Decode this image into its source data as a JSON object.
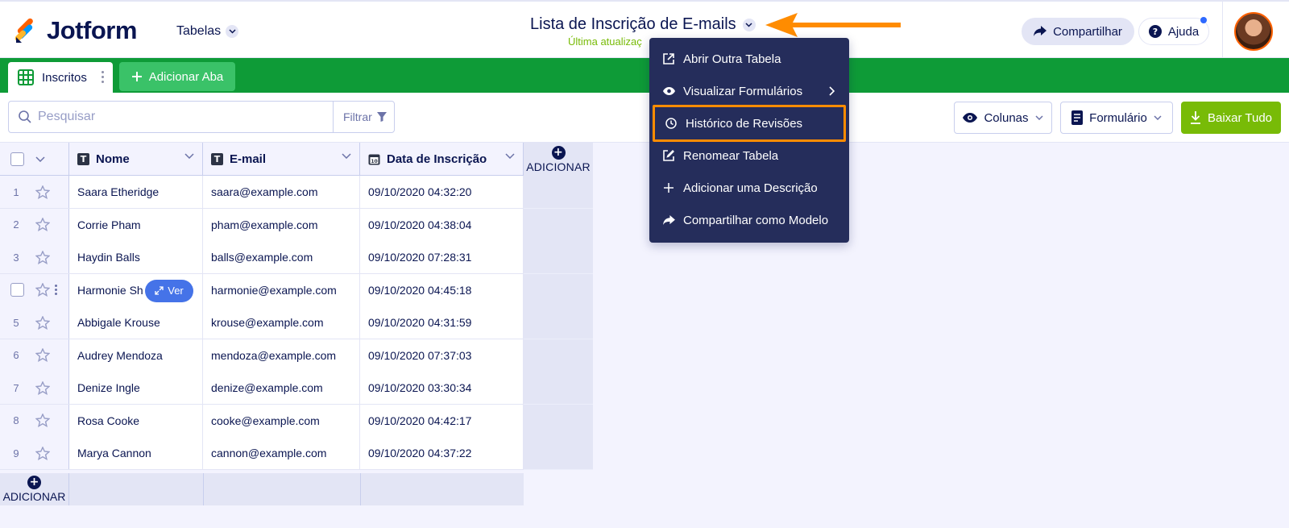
{
  "app": {
    "logo_text": "Jotform",
    "tables_label": "Tabelas",
    "table_title": "Lista de Inscrição de E-mails",
    "last_update": "Última atualizaç",
    "share_label": "Compartilhar",
    "help_label": "Ajuda"
  },
  "tabs": {
    "active_label": "Inscritos",
    "add_label": "Adicionar Aba"
  },
  "toolbar": {
    "search_placeholder": "Pesquisar",
    "filter_label": "Filtrar",
    "columns_label": "Colunas",
    "form_label": "Formulário",
    "download_label": "Baixar Tudo"
  },
  "grid": {
    "columns": [
      "Nome",
      "E-mail",
      "Data de Inscrição"
    ],
    "add_column_label": "ADICIONAR",
    "add_row_label": "ADICIONAR",
    "hover_view_label": "Ver",
    "rows": [
      {
        "num": "1",
        "nome": "Saara Etheridge",
        "email": "saara@example.com",
        "data": "09/10/2020 04:32:20"
      },
      {
        "num": "2",
        "nome": "Corrie Pham",
        "email": "pham@example.com",
        "data": "09/10/2020 04:38:04"
      },
      {
        "num": "3",
        "nome": "Haydin Balls",
        "email": "balls@example.com",
        "data": "09/10/2020 07:28:31"
      },
      {
        "num": "",
        "nome": "Harmonie Sh",
        "email": "harmonie@example.com",
        "data": "09/10/2020 04:45:18"
      },
      {
        "num": "5",
        "nome": "Abbigale Krouse",
        "email": "krouse@example.com",
        "data": "09/10/2020 04:31:59"
      },
      {
        "num": "6",
        "nome": "Audrey Mendoza",
        "email": "mendoza@example.com",
        "data": "09/10/2020 07:37:03"
      },
      {
        "num": "7",
        "nome": "Denize Ingle",
        "email": "denize@example.com",
        "data": "09/10/2020 03:30:34"
      },
      {
        "num": "8",
        "nome": "Rosa Cooke",
        "email": "cooke@example.com",
        "data": "09/10/2020 04:42:17"
      },
      {
        "num": "9",
        "nome": "Marya Cannon",
        "email": "cannon@example.com",
        "data": "09/10/2020 04:37:22"
      }
    ]
  },
  "menu": {
    "items": [
      {
        "label": "Abrir Outra Tabela",
        "icon": "external-link-icon"
      },
      {
        "label": "Visualizar Formulários",
        "icon": "eye-icon"
      },
      {
        "label": "Histórico de Revisões",
        "icon": "clock-icon"
      },
      {
        "label": "Renomear Tabela",
        "icon": "edit-icon"
      },
      {
        "label": "Adicionar uma Descrição",
        "icon": "plus-icon"
      },
      {
        "label": "Compartilhar como Modelo",
        "icon": "share-icon"
      }
    ]
  },
  "colors": {
    "brand_navy": "#0a1551",
    "tab_green": "#0e9b37",
    "download_green": "#78bb07",
    "menu_bg": "#252d5b",
    "highlight_orange": "#ff8c00"
  }
}
